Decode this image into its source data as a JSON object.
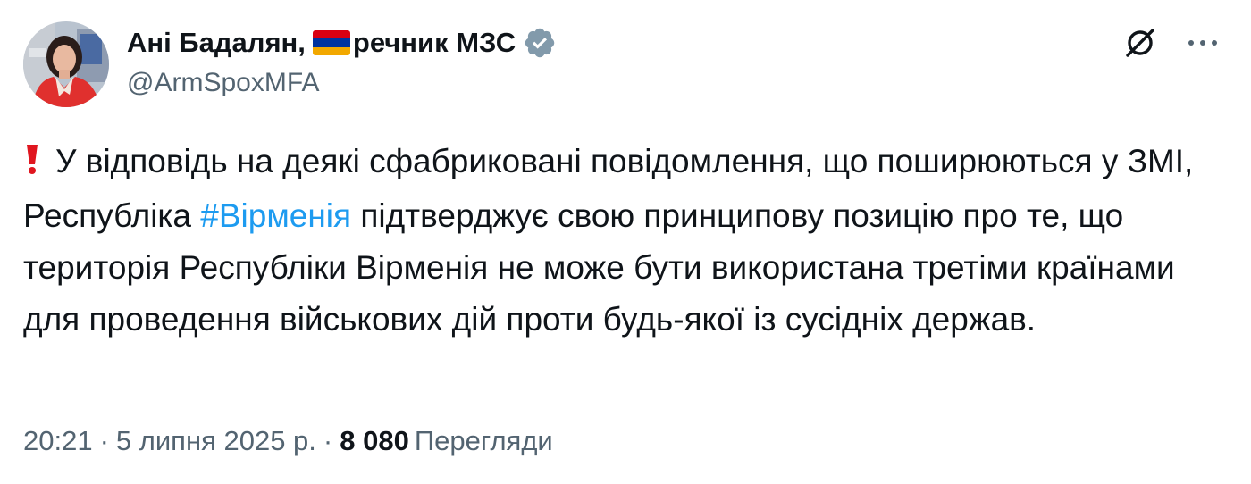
{
  "author": {
    "name_part1": "Ані Бадалян,",
    "name_part2": "речник МЗС",
    "handle": "@ArmSpoxMFA",
    "flag_colors": [
      "#d90012",
      "#0033a0",
      "#f2a800"
    ],
    "verified_color": "#829aab",
    "avatar_icon": "profile-photo"
  },
  "actions": {
    "grok_icon": "grok-icon",
    "more_icon": "more-icon"
  },
  "tweet": {
    "alert_icon": "red-exclamation-icon",
    "text_before_hashtag": "У відповідь на деякі сфабриковані повідомлення, що поширюються у ЗМІ, Республіка",
    "hashtag": "#Вірменія",
    "text_after_hashtag": "підтверджує свою принципову позицію про те, що територія Республіки Вірменія не може бути використана третіми країнами для проведення військових дій проти будь-якої із сусідніх держав."
  },
  "meta": {
    "time": "20:21",
    "separator": "·",
    "date": "5 липня 2025 р.",
    "views_count": "8 080",
    "views_label": "Перегляди"
  },
  "colors": {
    "text": "#0f1419",
    "secondary": "#536471",
    "link": "#1d9bf0",
    "alert": "#e0161f"
  }
}
